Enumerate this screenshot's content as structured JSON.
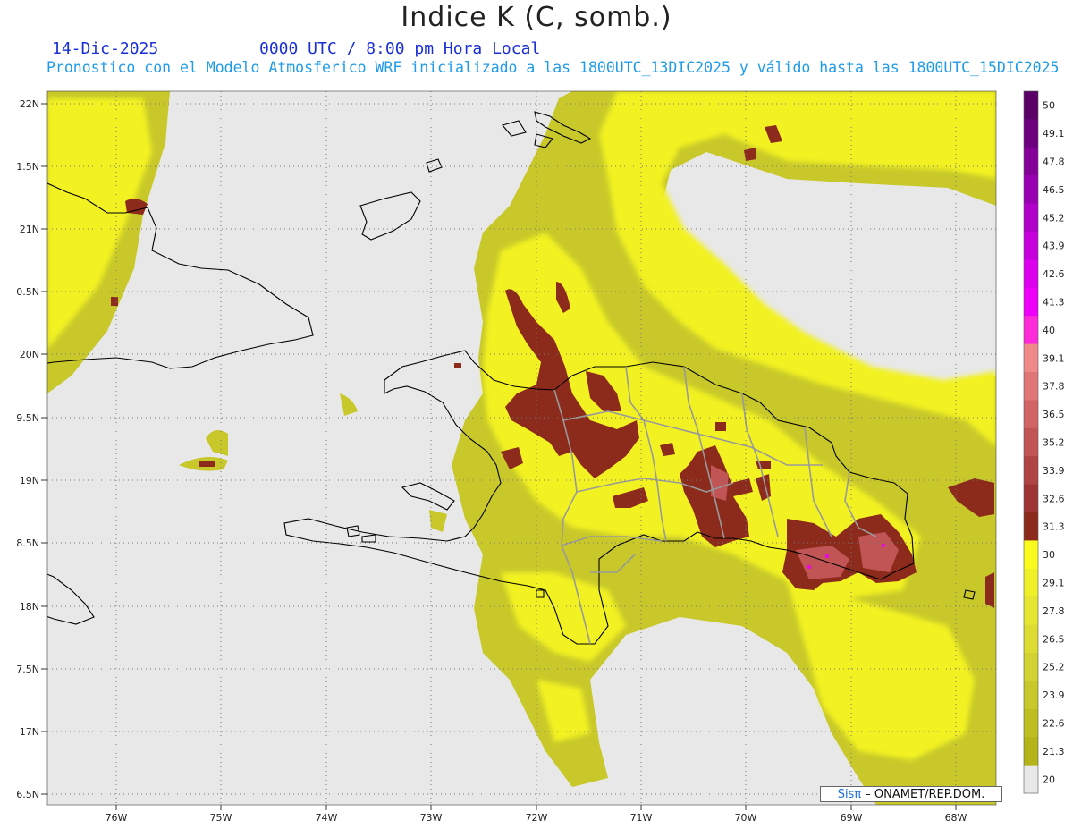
{
  "header": {
    "title": "Indice K (C, somb.)",
    "date": "14-Dic-2025",
    "time": "0000 UTC / 8:00 pm Hora Local",
    "subtitle": "Pronostico con el Modelo Atmosferico WRF inicializado a las 1800UTC_13DIC2025 y válido hasta las  1800UTC_15DIC2025"
  },
  "axes": {
    "lat_labels": [
      "22N",
      "1.5N",
      "21N",
      "0.5N",
      "20N",
      "9.5N",
      "19N",
      "8.5N",
      "18N",
      "7.5N",
      "17N",
      "6.5N"
    ],
    "lon_labels": [
      "76W",
      "75W",
      "74W",
      "73W",
      "72W",
      "71W",
      "70W",
      "69W",
      "68W"
    ]
  },
  "colorbar": {
    "labels": [
      "50",
      "49.1",
      "47.8",
      "46.5",
      "45.2",
      "43.9",
      "42.6",
      "41.3",
      "40",
      "39.1",
      "37.8",
      "36.5",
      "35.2",
      "33.9",
      "32.6",
      "31.3",
      "30",
      "29.1",
      "27.8",
      "26.5",
      "25.2",
      "23.9",
      "22.6",
      "21.3",
      "20"
    ],
    "colors": [
      "#5a0066",
      "#6e0080",
      "#840099",
      "#9a00b3",
      "#b000c9",
      "#c600dd",
      "#dc00ee",
      "#ee00f8",
      "#fc2ad8",
      "#f08a8a",
      "#e07676",
      "#d16464",
      "#c15454",
      "#b04444",
      "#9e3434",
      "#8c2a1c",
      "#fafa1e",
      "#f0f028",
      "#e6e632",
      "#dcdc32",
      "#d2d232",
      "#c8c82a",
      "#bebe20",
      "#b4b418",
      "#e8e8e8"
    ]
  },
  "colors": {
    "background": "#e8e8e8",
    "k_low": "#c8c82a",
    "k_mid": "#fafa1e",
    "k_high": "#8c2a1c",
    "coastline": "#000000",
    "borders": "#999999"
  },
  "credit": {
    "logo": "Sisπ",
    "text": " – ONAMET/REP.DOM."
  }
}
